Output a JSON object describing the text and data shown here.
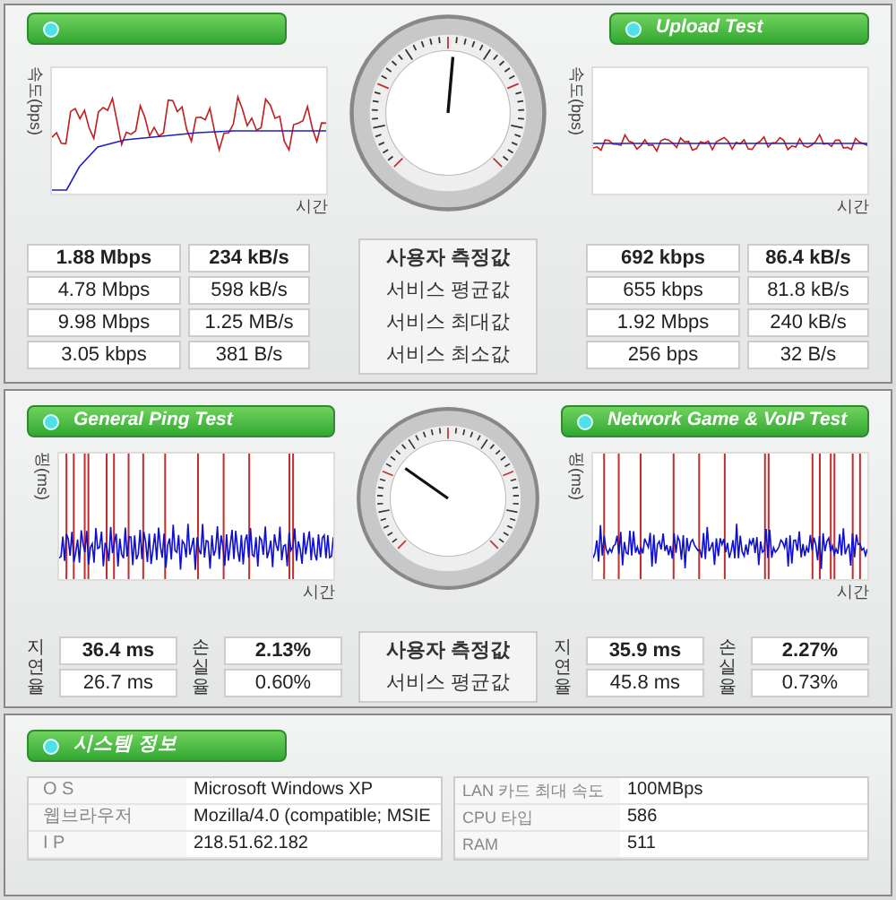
{
  "speed_panel": {
    "download": {
      "y_label": "속도(bps)",
      "x_label": "시간",
      "rows": [
        [
          "1.88 Mbps",
          "234 kB/s"
        ],
        [
          "4.78 Mbps",
          "598 kB/s"
        ],
        [
          "9.98 Mbps",
          "1.25 MB/s"
        ],
        [
          "3.05 kbps",
          "381 B/s"
        ]
      ]
    },
    "center_labels": [
      "사용자 측정값",
      "서비스 평균값",
      "서비스 최대값",
      "서비스 최소값"
    ],
    "upload": {
      "title": "Upload Test",
      "y_label": "속도(bps)",
      "x_label": "시간",
      "rows": [
        [
          "692 kbps",
          "86.4 kB/s"
        ],
        [
          "655 kbps",
          "81.8 kB/s"
        ],
        [
          "1.92 Mbps",
          "240 kB/s"
        ],
        [
          "256 bps",
          "32 B/s"
        ]
      ]
    }
  },
  "ping_panel": {
    "general": {
      "title": "General Ping Test",
      "y_label": "핑(ms)",
      "x_label": "시간",
      "latency_label": "지연율",
      "loss_label": "손실율",
      "latency": [
        "36.4 ms",
        "26.7 ms"
      ],
      "loss": [
        "2.13%",
        "0.60%"
      ]
    },
    "center_labels": [
      "사용자 측정값",
      "서비스 평균값"
    ],
    "game": {
      "title": "Network Game & VoIP Test",
      "y_label": "핑(ms)",
      "x_label": "시간",
      "latency_label": "지연율",
      "loss_label": "손실율",
      "latency": [
        "35.9 ms",
        "45.8 ms"
      ],
      "loss": [
        "2.27%",
        "0.73%"
      ]
    }
  },
  "system_panel": {
    "title": "시스템 정보",
    "left_rows": [
      {
        "label": "O S",
        "value": "Microsoft Windows XP"
      },
      {
        "label": "웹브라우저",
        "value": "Mozilla/4.0 (compatible; MSIE"
      },
      {
        "label": "I P",
        "value": "218.51.62.182"
      }
    ],
    "right_rows": [
      {
        "label": "LAN 카드 최대 속도",
        "value": "100MBps"
      },
      {
        "label": "CPU 타입",
        "value": "586"
      },
      {
        "label": "RAM",
        "value": "511"
      }
    ]
  }
}
